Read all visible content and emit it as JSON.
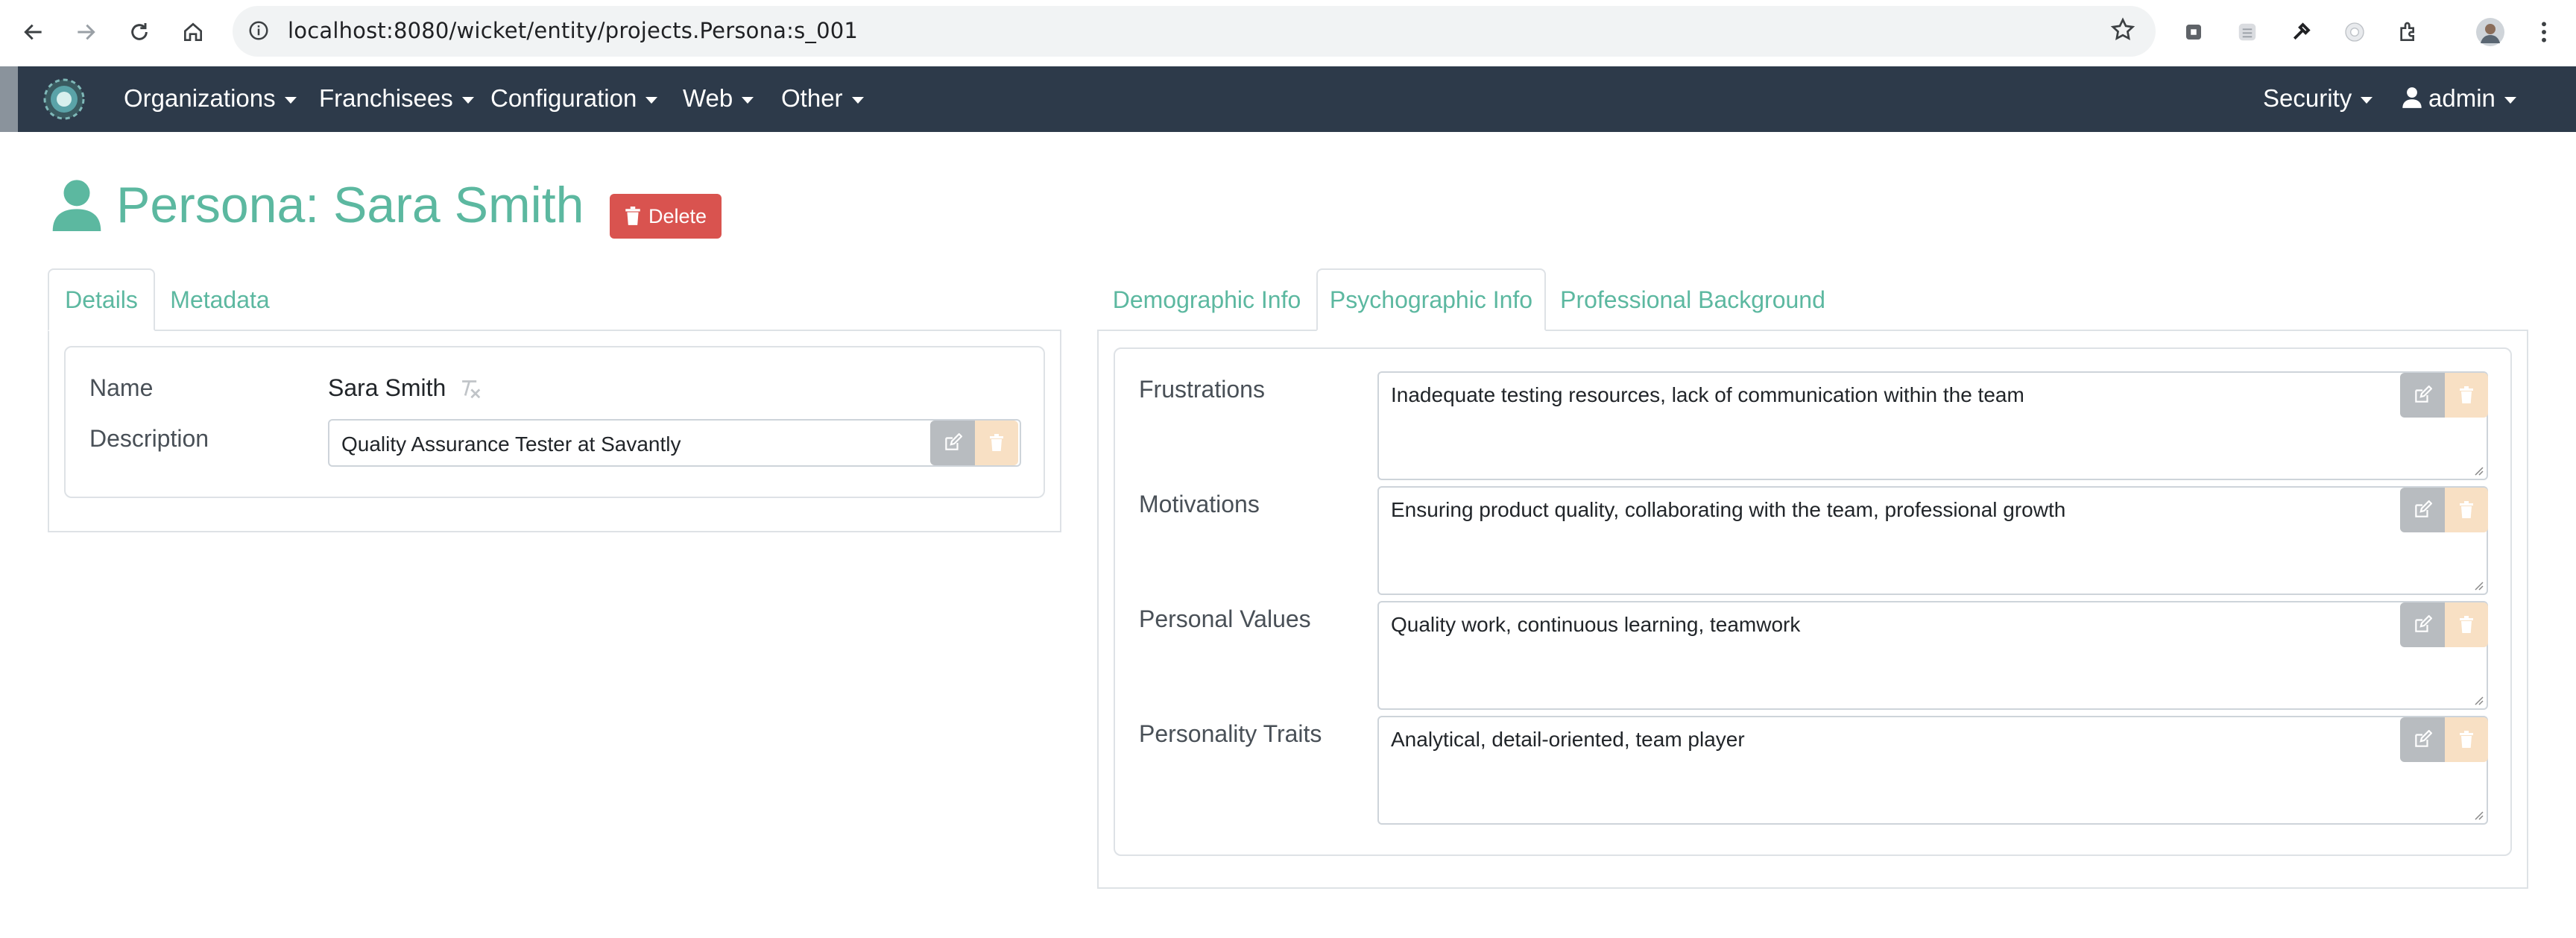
{
  "browser": {
    "url": "localhost:8080/wicket/entity/projects.Persona:s_001"
  },
  "navbar": {
    "menus": [
      "Organizations",
      "Franchisees",
      "Configuration",
      "Web",
      "Other"
    ],
    "security_label": "Security",
    "user_label": "admin"
  },
  "page": {
    "title": "Persona: Sara Smith",
    "delete_label": "Delete"
  },
  "left_tabs": [
    "Details",
    "Metadata"
  ],
  "details": {
    "name_label": "Name",
    "name_value": "Sara Smith",
    "description_label": "Description",
    "description_value": "Quality Assurance Tester at Savantly"
  },
  "right_tabs": [
    "Demographic Info",
    "Psychographic Info",
    "Professional Background"
  ],
  "psychographic": {
    "fields": [
      {
        "label": "Frustrations",
        "value": "Inadequate testing resources, lack of communication within the team"
      },
      {
        "label": "Motivations",
        "value": "Ensuring product quality, collaborating with the team, professional growth"
      },
      {
        "label": "Personal Values",
        "value": "Quality work, continuous learning, teamwork"
      },
      {
        "label": "Personality Traits",
        "value": "Analytical, detail-oriented, team player"
      }
    ]
  },
  "colors": {
    "accent": "#5cb8a0",
    "navbar": "#2d3a4a",
    "danger": "#d9534f"
  }
}
